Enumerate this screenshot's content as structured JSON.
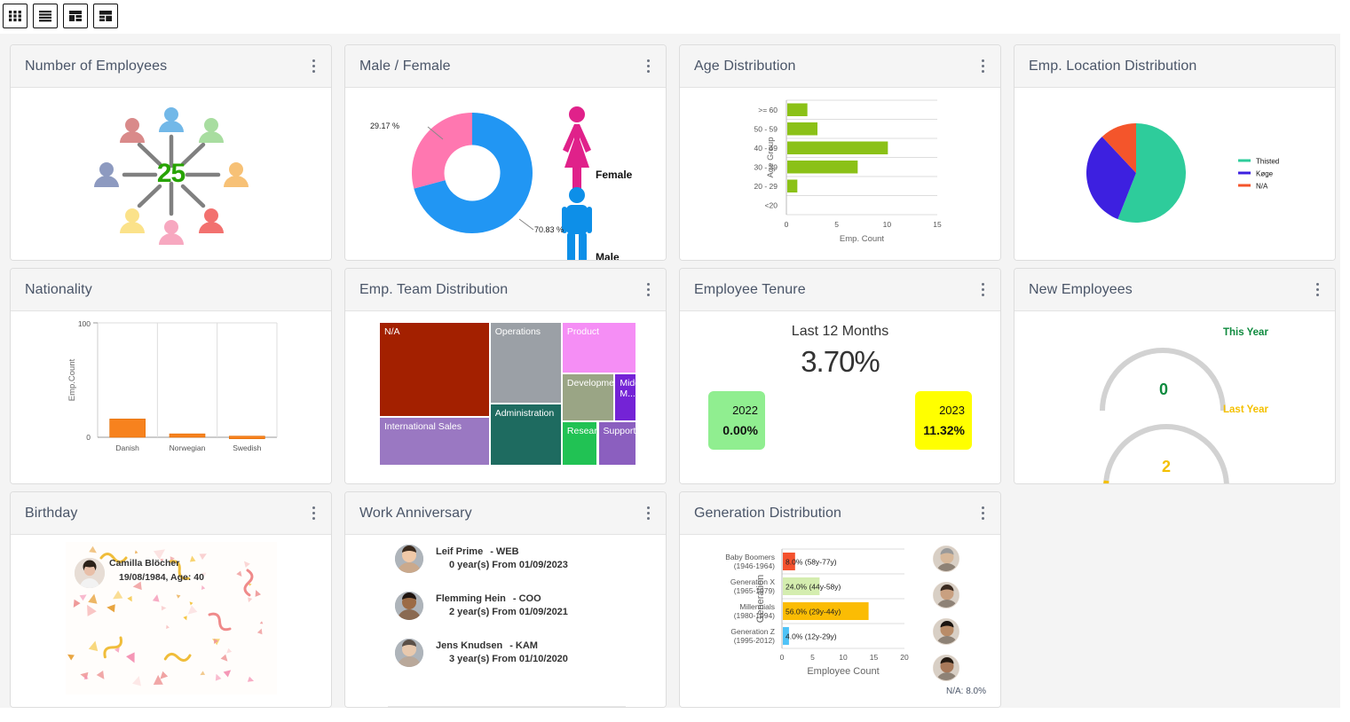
{
  "toolbar": {
    "buttons": [
      {
        "name": "layout-grid-icon",
        "label": "Grid layout"
      },
      {
        "name": "layout-rows-icon",
        "label": "Rows layout"
      },
      {
        "name": "layout-split-icon",
        "label": "Split layout"
      },
      {
        "name": "layout-mixed-icon",
        "label": "Mixed layout"
      }
    ]
  },
  "cards": {
    "employees": {
      "title": "Number of Employees",
      "value": "25",
      "value_color": "#27a300",
      "person_colors": [
        "#72b8e8",
        "#a8dda0",
        "#f7c176",
        "#f2716f",
        "#f7a8c0",
        "#fbe28a",
        "#8d9ac0",
        "#d98a8a"
      ]
    },
    "gender": {
      "title": "Male / Female",
      "female_pct": "29.17 %",
      "male_pct": "70.83 %",
      "female_label": "Female",
      "male_label": "Male",
      "female_color": "#ff77b0",
      "male_color": "#2196f3",
      "female_icon_color": "#e0218a",
      "male_icon_color": "#0d8fe8"
    },
    "age": {
      "title": "Age Distribution"
    },
    "location": {
      "title": "Emp. Location Distribution"
    },
    "nationality": {
      "title": "Nationality"
    },
    "team": {
      "title": "Emp. Team Distribution",
      "tiles": [
        {
          "label": "N/A",
          "color": "#a32000"
        },
        {
          "label": "Operations",
          "color": "#9ba0a6"
        },
        {
          "label": "Product",
          "color": "#f58ef5"
        },
        {
          "label": "International Sales",
          "color": "#9a78c2"
        },
        {
          "label": "Administration",
          "color": "#1e6b60"
        },
        {
          "label": "Development",
          "color": "#9aa585"
        },
        {
          "label": "Middle M...",
          "color": "#7423d6"
        },
        {
          "label": "Research",
          "color": "#21c254"
        },
        {
          "label": "Support",
          "color": "#8b5fbf"
        }
      ]
    },
    "tenure": {
      "title": "Employee Tenure",
      "subtitle": "Last 12 Months",
      "value": "3.70%",
      "left_year": "2022",
      "left_value": "0.00%",
      "left_color": "#90ee90",
      "right_year": "2023",
      "right_value": "11.32%",
      "right_color": "#ffff00"
    },
    "new_employees": {
      "title": "New Employees",
      "this_year_label": "This Year",
      "this_year_value": "0",
      "this_year_color": "#0e8a3e",
      "last_year_label": "Last Year",
      "last_year_value": "2",
      "last_year_color": "#f4c000"
    },
    "birthday": {
      "title": "Birthday",
      "person_name": "Camilla Blöcher",
      "person_date": "19/08/1984, Age: 40"
    },
    "anniversary": {
      "title": "Work Anniversary",
      "rows": [
        {
          "name": "Leif Prime",
          "role": "- WEB",
          "detail": "0 year(s) From 01/09/2023"
        },
        {
          "name": "Flemming Hein",
          "role": "- COO",
          "detail": "2 year(s) From 01/09/2021"
        },
        {
          "name": "Jens Knudsen",
          "role": "- KAM",
          "detail": "3 year(s) From 01/10/2020"
        }
      ]
    },
    "generation": {
      "title": "Generation Distribution",
      "na_label": "N/A: 8.0%"
    }
  },
  "chart_data": [
    {
      "type": "bar",
      "id": "age-distribution",
      "orientation": "horizontal",
      "title": "Age Distribution",
      "categories": [
        ">= 60",
        "50 - 59",
        "40 - 49",
        "30 - 39",
        "20 - 29",
        "<20"
      ],
      "values": [
        2,
        3,
        10,
        7,
        1,
        0
      ],
      "xlabel": "Emp. Count",
      "ylabel": "Age Group",
      "xlim": [
        0,
        15
      ],
      "xticks": [
        0,
        5,
        10,
        15
      ],
      "color": "#8bc117",
      "grid": true,
      "legend": "none"
    },
    {
      "type": "pie",
      "id": "gender-donut",
      "title": "Male / Female",
      "labels": [
        "Male",
        "Female"
      ],
      "values": [
        70.83,
        29.17
      ],
      "value_labels": [
        "70.83 %",
        "29.17 %"
      ],
      "colors": [
        "#2196f3",
        "#ff77b0"
      ],
      "donut": true,
      "legend": "right"
    },
    {
      "type": "pie",
      "id": "location-pie",
      "title": "Emp. Location Distribution",
      "labels": [
        "Thisted",
        "Køge",
        "N/A"
      ],
      "values": [
        56,
        32,
        12
      ],
      "colors": [
        "#2ecc9b",
        "#3d20e0",
        "#f4552b"
      ],
      "donut": false,
      "legend": "right"
    },
    {
      "type": "bar",
      "id": "nationality",
      "orientation": "vertical",
      "title": "Nationality",
      "categories": [
        "Danish",
        "Norwegian",
        "Swedish"
      ],
      "values": [
        16,
        3,
        1
      ],
      "xlabel": "",
      "ylabel": "Emp.Count",
      "ylim": [
        0,
        100
      ],
      "yticks": [
        0,
        100
      ],
      "color": "#f7821e",
      "grid": false,
      "legend": "none"
    },
    {
      "type": "bar",
      "id": "generation-distribution",
      "orientation": "horizontal",
      "title": "Generation Distribution",
      "categories": [
        "Baby Boomers\n(1946-1964)",
        "Generation X\n(1965-1979)",
        "Millennials\n(1980-1994)",
        "Generation Z\n(1995-2012)"
      ],
      "values": [
        2,
        6,
        14,
        1
      ],
      "data_labels": [
        "8.0% (58y-77y)",
        "24.0% (44y-58y)",
        "56.0% (29y-44y)",
        "4.0% (12y-29y)"
      ],
      "colors": [
        "#f4522e",
        "#d4edaf",
        "#fbbc04",
        "#4fc3f7"
      ],
      "xlabel": "Employee Count",
      "ylabel": "Generation",
      "xlim": [
        0,
        20
      ],
      "xticks": [
        0,
        5,
        10,
        15,
        20
      ],
      "grid": true,
      "legend": "none",
      "annotation": "N/A: 8.0%"
    },
    {
      "type": "treemap",
      "id": "team-distribution",
      "title": "Emp. Team Distribution",
      "labels": [
        "N/A",
        "Operations",
        "Product",
        "International Sales",
        "Administration",
        "Development",
        "Middle M...",
        "Research",
        "Support"
      ],
      "colors": [
        "#a32000",
        "#9ba0a6",
        "#f58ef5",
        "#9a78c2",
        "#1e6b60",
        "#9aa585",
        "#7423d6",
        "#21c254",
        "#8b5fbf"
      ]
    },
    {
      "type": "gauge",
      "id": "new-employees",
      "title": "New Employees",
      "series": [
        {
          "name": "This Year",
          "value": 0,
          "max": 20,
          "color": "#0e8a3e"
        },
        {
          "name": "Last Year",
          "value": 2,
          "max": 20,
          "color": "#f4c000"
        }
      ]
    }
  ]
}
